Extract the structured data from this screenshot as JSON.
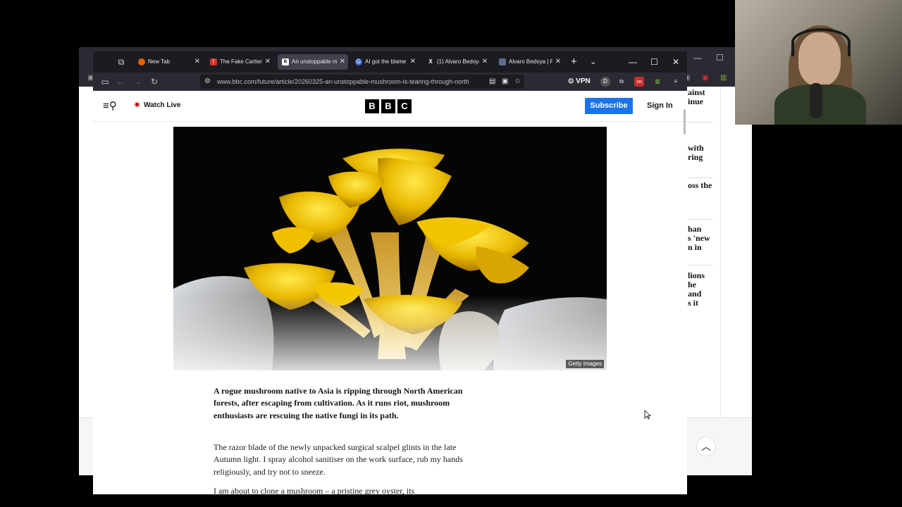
{
  "browser": {
    "tabs": [
      {
        "title": "New Tab",
        "favicon": "firefox-icon",
        "active": false
      },
      {
        "title": "The Fake Cartier a",
        "favicon": "red-i-icon",
        "active": false
      },
      {
        "title": "An unstoppable m",
        "favicon": "bbc-icon",
        "active": true
      },
      {
        "title": "AI got the blame f",
        "favicon": "g-icon",
        "active": false
      },
      {
        "title": "(1) Alvaro Bedoya",
        "favicon": "x-icon",
        "active": false
      },
      {
        "title": "Alvaro Bedoya | Fe",
        "favicon": "doc-icon",
        "active": false
      }
    ],
    "url": "www.bbc.com/future/article/20260325-an-unstoppable-mushroom-is-tearing-through-north",
    "vpn_label": "VPN",
    "ext_badge_1": "189",
    "ext_badge_2": "59"
  },
  "header": {
    "watch_live": "Watch Live",
    "logo_letters": [
      "B",
      "B",
      "C"
    ],
    "subscribe": "Subscribe",
    "sign_in": "Sign In"
  },
  "hero": {
    "credit": "Getty Images"
  },
  "article": {
    "lead": "A rogue mushroom native to Asia is ripping through North American forests, after escaping from cultivation. As it runs riot, mushroom enthusiasts are rescuing the native fungi in its path.",
    "p1": "The razor blade of the newly unpacked surgical scalpel glints in the late Autumn light. I spray alcohol sanitiser on the work surface, rub my hands religiously, and try not to sneeze.",
    "p2": "I am about to clone a mushroom – a pristine grey oyster, its"
  },
  "background_window": {
    "fragments": [
      "ainst",
      "inue",
      "with",
      "ring",
      "oss the",
      "han",
      "s 'new",
      "n in",
      "lions",
      "he",
      "and",
      "s it"
    ]
  }
}
